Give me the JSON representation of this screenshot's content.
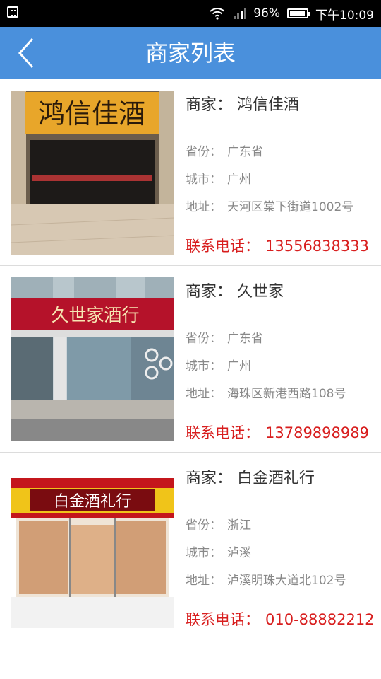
{
  "status_bar": {
    "battery_level": 0.96,
    "battery_text": "96%",
    "time": "下午10:09"
  },
  "header": {
    "title": "商家列表"
  },
  "labels": {
    "merchant": "商家：",
    "province": "省份：",
    "city": "城市：",
    "address": "地址：",
    "phone": "联系电话："
  },
  "merchants": [
    {
      "name": "鸿信佳酒",
      "province": "广东省",
      "city": "广州",
      "address": "天河区棠下街道1002号",
      "phone": "13556838333",
      "sign_text": "鸿信佳酒"
    },
    {
      "name": "久世家",
      "province": "广东省",
      "city": "广州",
      "address": "海珠区新港西路108号",
      "phone": "13789898989",
      "sign_text": "久世家酒行"
    },
    {
      "name": "白金酒礼行",
      "province": "浙江",
      "city": "泸溪",
      "address": "泸溪明珠大道北102号",
      "phone": "010-88882212",
      "sign_text": "白金酒礼行"
    }
  ],
  "colors": {
    "header": "#4a90dc",
    "phone": "#d81e1e"
  }
}
